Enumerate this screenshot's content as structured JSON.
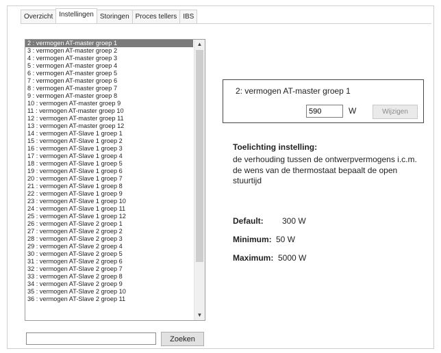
{
  "tabs": [
    "Overzicht",
    "Instellingen",
    "Storingen",
    "Proces tellers",
    "IBS"
  ],
  "active_tab": "Instellingen",
  "list": {
    "items": [
      "2 : vermogen AT-master groep 1",
      "3 : vermogen AT-master groep 2",
      "4 : vermogen AT-master groep 3",
      "5 : vermogen AT-master groep 4",
      "6 : vermogen AT-master groep 5",
      "7 : vermogen AT-master groep 6",
      "8 : vermogen AT-master groep 7",
      "9 : vermogen AT-master groep 8",
      "10 : vermogen AT-master groep 9",
      "11 : vermogen AT-master groep 10",
      "12 : vermogen AT-master groep 11",
      "13 : vermogen AT-master groep 12",
      "14 : vermogen AT-Slave 1 groep 1",
      "15 : vermogen AT-Slave 1 groep 2",
      "16 : vermogen AT-Slave 1 groep 3",
      "17 : vermogen AT-Slave 1 groep 4",
      "18 : vermogen AT-Slave 1 groep 5",
      "19 : vermogen AT-Slave 1 groep 6",
      "20 : vermogen AT-Slave 1 groep 7",
      "21 : vermogen AT-Slave 1 groep 8",
      "22 : vermogen AT-Slave 1 groep 9",
      "23 : vermogen AT-Slave 1 groep 10",
      "24 : vermogen AT-Slave 1 groep 11",
      "25 : vermogen AT-Slave 1 groep 12",
      "26 : vermogen AT-Slave 2 groep 1",
      "27 : vermogen AT-Slave 2 groep 2",
      "28 : vermogen AT-Slave 2 groep 3",
      "29 : vermogen AT-Slave 2 groep 4",
      "30 : vermogen AT-Slave 2 groep 5",
      "31 : vermogen AT-Slave 2 groep 6",
      "32 : vermogen AT-Slave 2 groep 7",
      "33 : vermogen AT-Slave 2 groep 8",
      "34 : vermogen AT-Slave 2 groep 9",
      "35 : vermogen AT-Slave 2 groep 10",
      "36 : vermogen AT-Slave 2 groep 11"
    ],
    "selected_index": 0
  },
  "scroll_up_icon": "▲",
  "scroll_down_icon": "▼",
  "search": {
    "value": "",
    "button_label": "Zoeken"
  },
  "setting": {
    "title": "2: vermogen AT-master groep 1",
    "value": "590",
    "unit": "W",
    "change_label": "Wijzigen"
  },
  "explanation": {
    "title": "Toelichting instelling:",
    "text": "de verhouding tussen de ontwerpvermogens i.c.m. de wens van de thermostaat bepaalt de open stuurtijd"
  },
  "defaults": {
    "default_label": "Default:",
    "default_value": "300 W",
    "minimum_label": "Minimum:",
    "minimum_value": "50 W",
    "maximum_label": "Maximum:",
    "maximum_value": "5000 W"
  }
}
